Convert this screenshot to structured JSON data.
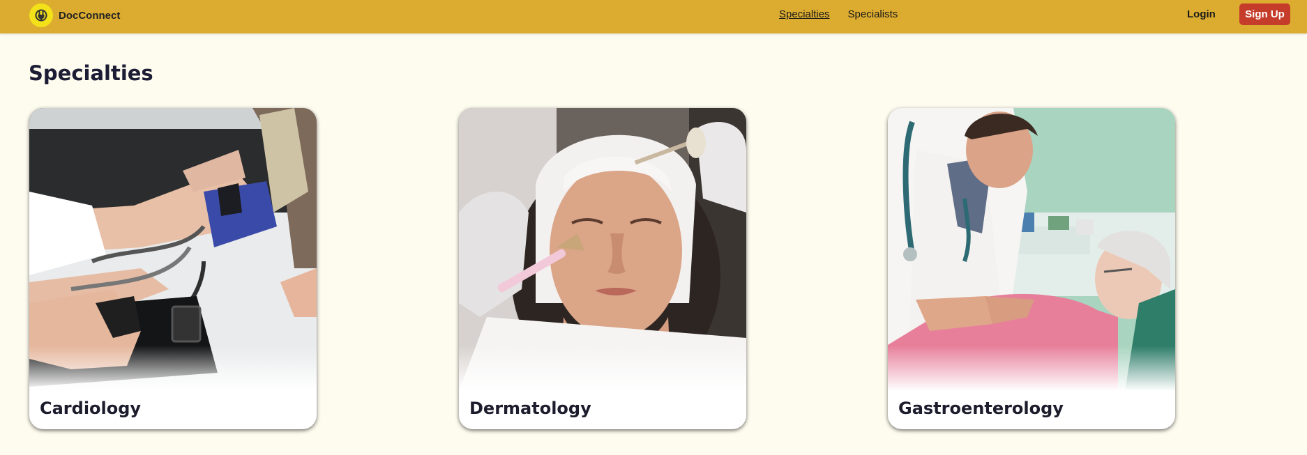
{
  "brand": {
    "name": "DocConnect",
    "icon": "plug-icon"
  },
  "nav": {
    "links": [
      {
        "label": "Specialties",
        "active": true
      },
      {
        "label": "Specialists",
        "active": false
      }
    ],
    "login_label": "Login",
    "signup_label": "Sign Up"
  },
  "main": {
    "title": "Specialties",
    "cards": [
      {
        "label": "Cardiology",
        "image": "blood-pressure-measurement-photo"
      },
      {
        "label": "Dermatology",
        "image": "facial-skin-treatment-photo"
      },
      {
        "label": "Gastroenterology",
        "image": "doctor-examining-patient-photo"
      }
    ]
  },
  "colors": {
    "header": "#dcac30",
    "background": "#fefcef",
    "signup": "#c53d2a",
    "logo": "#f3e21a",
    "title": "#1c1c34"
  }
}
